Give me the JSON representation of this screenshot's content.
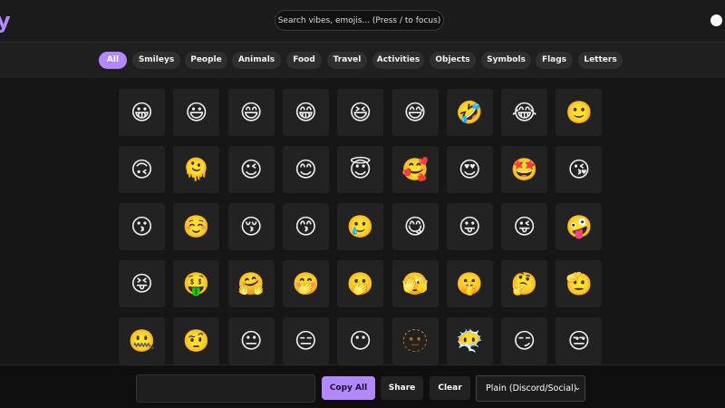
{
  "header": {
    "logo_text": "y",
    "search_placeholder": "Search vibes, emojis... (Press / to focus)"
  },
  "categories": [
    "All",
    "Smileys",
    "People",
    "Animals",
    "Food",
    "Travel",
    "Activities",
    "Objects",
    "Symbols",
    "Flags",
    "Letters"
  ],
  "active_category": "All",
  "emojis": [
    [
      "😀",
      "😃",
      "😄",
      "😁",
      "😆",
      "😅",
      "🤣",
      "😂",
      "🙂"
    ],
    [
      "🙃",
      "🫠",
      "😉",
      "😊",
      "😇",
      "🥰",
      "😍",
      "🤩",
      "😘"
    ],
    [
      "😗",
      "☺️",
      "😚",
      "😙",
      "🥲",
      "😋",
      "😛",
      "😜",
      "🤪"
    ],
    [
      "😝",
      "🤑",
      "🤗",
      "🤭",
      "🫢",
      "🫣",
      "🤫",
      "🤔",
      "🫡"
    ],
    [
      "🤐",
      "🤨",
      "😐",
      "😑",
      "😶",
      "🫥",
      "😶‍🌫️",
      "😏",
      "😒"
    ]
  ],
  "footer": {
    "copy_all_label": "Copy All",
    "share_label": "Share",
    "clear_label": "Clear",
    "format_selected": "Plain (Discord/Social)",
    "format_chevron": "⌄"
  },
  "colors": {
    "accent": "#b388ff",
    "background": "#161616"
  }
}
